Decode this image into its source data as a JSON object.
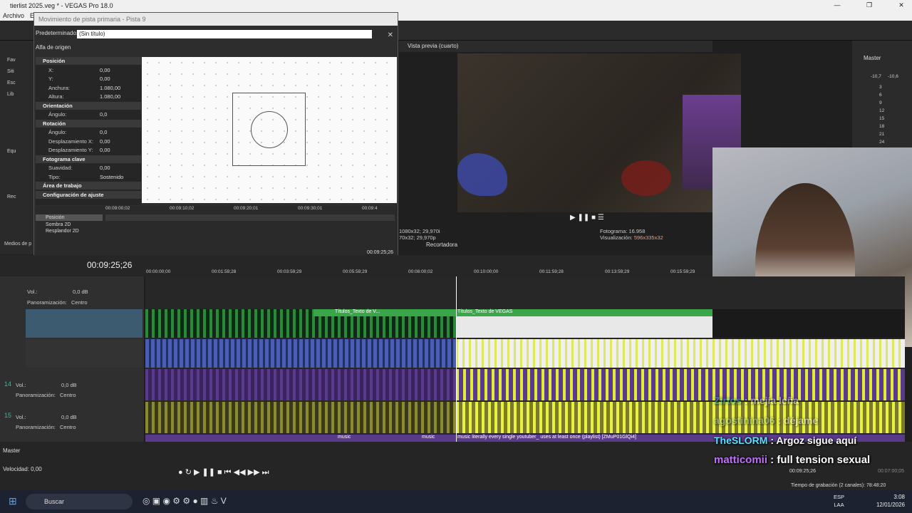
{
  "window": {
    "title": "tierlist 2025.veg * - VEGAS Pro 18.0",
    "minimize": "—",
    "maximize": "❐",
    "close": "✕"
  },
  "menu": [
    "Archivo",
    "E"
  ],
  "dialog": {
    "title": "Movimiento de pista primaria - Pista 9",
    "preset_label": "Predeterminado:",
    "preset_value": "(Sin título)",
    "source_alpha": "Alfa de origen",
    "properties": [
      {
        "type": "hdr",
        "label": "Posición"
      },
      {
        "type": "row",
        "label": "X:",
        "value": "0,00"
      },
      {
        "type": "row",
        "label": "Y:",
        "value": "0,00"
      },
      {
        "type": "row",
        "label": "Anchura:",
        "value": "1.080,00"
      },
      {
        "type": "row",
        "label": "Altura:",
        "value": "1.080,00"
      },
      {
        "type": "hdr",
        "label": "Orientación"
      },
      {
        "type": "row",
        "label": "Ángulo:",
        "value": "0,0"
      },
      {
        "type": "hdr",
        "label": "Rotación"
      },
      {
        "type": "row",
        "label": "Ángulo:",
        "value": "0,0"
      },
      {
        "type": "row",
        "label": "Desplazamiento X:",
        "value": "0,00"
      },
      {
        "type": "row",
        "label": "Desplazamiento Y:",
        "value": "0,00"
      },
      {
        "type": "hdr",
        "label": "Fotograma clave"
      },
      {
        "type": "row",
        "label": "Suavidad:",
        "value": "0,00"
      },
      {
        "type": "row",
        "label": "Tipo:",
        "value": "Sostenido"
      },
      {
        "type": "hdr",
        "label": "Área de trabajo"
      },
      {
        "type": "hdr",
        "label": "Configuración de ajuste"
      }
    ],
    "ruler": [
      "00:09:00;02",
      "00:09:10;02",
      "00:09:20;01",
      "00:09:30;01",
      "00:09:4"
    ],
    "lanes": [
      "Posición",
      "Sombra 2D",
      "Resplandor 2D"
    ],
    "kf_time": "00:09:25;26"
  },
  "left_explorer": [
    "Fav",
    "Siti",
    "Esc",
    "Lib",
    "Equ",
    "Rec"
  ],
  "left_media": "Medios de p",
  "preview": {
    "mode": "Vista previa (cuarto)",
    "project_res": "1080x32; 29,970i",
    "project_res2": "70x32; 29,970p",
    "frame_label": "Fotograma:",
    "frame_value": "16.958",
    "display_label": "Visualización:",
    "display_value": "596x335x32",
    "recorder_tab": "Recortadora",
    "controls": "▶ ❚❚ ■ ☰"
  },
  "master": {
    "label": "Master",
    "db_left": "-10,7",
    "db_right": "-10,6",
    "scale": [
      "3",
      "6",
      "9",
      "12",
      "15",
      "18",
      "21",
      "24"
    ]
  },
  "timeline": {
    "timecode": "00:09:25;26",
    "ruler": [
      "00:00:00;00",
      "00:01:59;28",
      "00:03:59;29",
      "00:05:59;29",
      "00:08:00;02",
      "00:10:00;00",
      "00:11:59;28",
      "00:13:59;29",
      "00:15:59;29"
    ],
    "track_labels": {
      "vol": "Vol.:",
      "vol_value": "0,0 dB",
      "pan": "Panoramización:",
      "pan_value": "Centro"
    },
    "track_numbers": [
      "14",
      "15"
    ],
    "clip_titles": [
      "Títulos_Texto de V...",
      "Títulos_Texto de VEGAS"
    ],
    "music_clip": "music literally every single youtuber_ uses at least once (playlist) [ZMuP01GlQi4]",
    "music_short": "music",
    "master_label": "Master",
    "speed_label": "Velocidad: 0,00",
    "bottom_time": "00:09:25;26",
    "bottom_time2": "00:07:00;05",
    "record_time": "Tiempo de grabación (2 canales): 78:48:20"
  },
  "chat": [
    {
      "user": "Zirtos",
      "msg": "mejía leña"
    },
    {
      "user": "agostinina06",
      "msg": "déjame"
    },
    {
      "user": "TheSLORM",
      "msg": "Argoz sigue aquí"
    },
    {
      "user": "matticomii",
      "msg": "full tension sexual"
    }
  ],
  "taskbar": {
    "search": "Buscar",
    "lang1": "ESP",
    "lang2": "LAA",
    "time": "3:08",
    "date": "12/01/2026"
  }
}
